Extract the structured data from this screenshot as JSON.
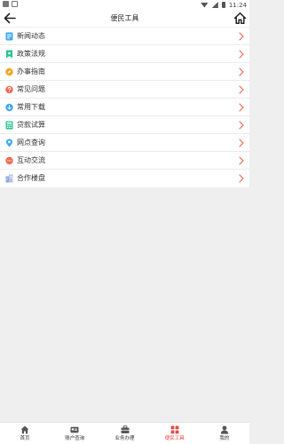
{
  "status_bar": {
    "time": "11:24"
  },
  "header": {
    "title": "便民工具"
  },
  "menu": [
    {
      "label": "新闻动态",
      "icon": "news-icon",
      "color": "#3ba7f2"
    },
    {
      "label": "政策法规",
      "icon": "bookmark-icon",
      "color": "#2bc489"
    },
    {
      "label": "办事指南",
      "icon": "compass-icon",
      "color": "#f4a51c"
    },
    {
      "label": "常见问题",
      "icon": "question-icon",
      "color": "#f06a55"
    },
    {
      "label": "常用下载",
      "icon": "download-icon",
      "color": "#3ba7f2"
    },
    {
      "label": "贷款试算",
      "icon": "calculator-icon",
      "color": "#2bc489"
    },
    {
      "label": "网点查询",
      "icon": "location-icon",
      "color": "#3ba7f2"
    },
    {
      "label": "互动交流",
      "icon": "chat-icon",
      "color": "#f06a55"
    },
    {
      "label": "合作楼盘",
      "icon": "building-icon",
      "color": "#8fa4d8"
    }
  ],
  "bottom_nav": [
    {
      "label": "首页",
      "icon": "home-icon",
      "active": false
    },
    {
      "label": "账户查询",
      "icon": "account-card-icon",
      "active": false
    },
    {
      "label": "业务办理",
      "icon": "briefcase-icon",
      "active": false
    },
    {
      "label": "便民工具",
      "icon": "grid-icon",
      "active": true
    },
    {
      "label": "我的",
      "icon": "user-icon",
      "active": false
    }
  ],
  "colors": {
    "accent": "#e8493f",
    "chevron": "#f06a55"
  }
}
